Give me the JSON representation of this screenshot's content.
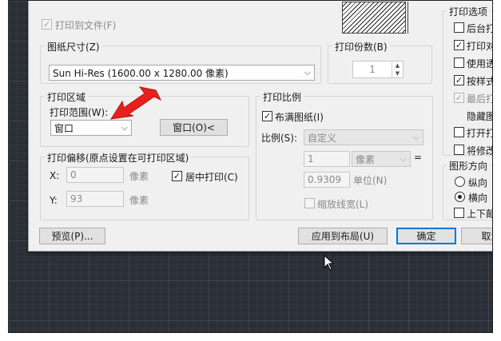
{
  "dialog": {
    "print_to_file_label": "打印到文件(F)",
    "paper_size": {
      "title": "图纸尺寸(Z)",
      "value": "Sun Hi-Res (1600.00 x 1280.00 像素)"
    },
    "copies": {
      "title": "打印份数(B)",
      "value": "1"
    },
    "plot_area": {
      "title": "打印区域",
      "what_to_plot_label": "打印范围(W):",
      "what_to_plot_value": "窗口",
      "window_button": "窗口(O)<"
    },
    "plot_offset": {
      "title": "打印偏移(原点设置在可打印区域)",
      "x_label": "X:",
      "x_value": "0",
      "x_unit": "像素",
      "y_label": "Y:",
      "y_value": "93",
      "y_unit": "像素",
      "center_label": "居中打印(C)"
    },
    "plot_scale": {
      "title": "打印比例",
      "fit_label": "布满图纸(I)",
      "scale_label": "比例(S):",
      "scale_value": "自定义",
      "num_value": "1",
      "unit_value": "像素",
      "equals": "=",
      "den_value": "0.9309",
      "den_unit": "单位(N)",
      "lineweights_label": "缩放线宽(L)"
    },
    "options": {
      "title": "打印选项",
      "items": [
        {
          "label": "后台打",
          "checked": false,
          "enabled": true
        },
        {
          "label": "打印对",
          "checked": true,
          "enabled": true
        },
        {
          "label": "使用透",
          "checked": false,
          "enabled": true
        },
        {
          "label": "按样式",
          "checked": true,
          "enabled": true
        },
        {
          "label": "最后打",
          "checked": true,
          "enabled": false
        },
        {
          "label": "隐藏图",
          "checked": false,
          "enabled": true
        },
        {
          "label": "打开打",
          "checked": false,
          "enabled": true
        },
        {
          "label": "将修改",
          "checked": false,
          "enabled": true
        }
      ]
    },
    "orientation": {
      "title": "图形方向",
      "portrait": "纵向",
      "landscape": "横向",
      "upside_down": "上下颠"
    },
    "buttons": {
      "preview": "预览(P)...",
      "apply": "应用到布局(U)",
      "ok": "确定",
      "cancel": "取消"
    }
  },
  "colors": {
    "annotation_arrow": "#e8201b",
    "canvas_bg": "#2b3038",
    "dialog_bg": "#f0f0f0",
    "default_button_border": "#0078d7"
  }
}
